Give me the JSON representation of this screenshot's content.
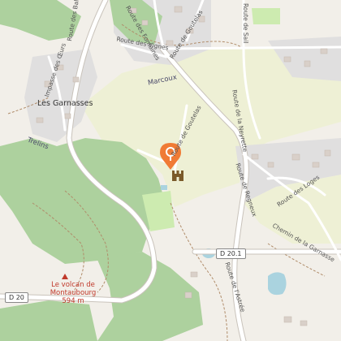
{
  "map": {
    "places": {
      "garnasses": "Les Garnasses",
      "marcoux": "Marcoux",
      "trelins": "Trelins"
    },
    "roads": {
      "balcons": "Route des Balcons",
      "oeurs": "Impasse des Œurs",
      "fontaines": "Route des Fontaines",
      "vignes": "Route des Vignes",
      "goutelas_top": "Route de Goutelas",
      "goutelas_mid": "Route de Goutelas",
      "sail": "Route de Sail",
      "neyrette": "Route de la Neyrette",
      "regneux": "Route de Regneux",
      "loges": "Route des Loges",
      "garnasse_chemin": "Chemin de la Garnasse",
      "astree": "Route de l'Astrée"
    },
    "shields": {
      "d201": "D 20.1",
      "d20": "D 20"
    },
    "peak": {
      "name": "Le volcan de Montaubourg",
      "elevation": "594 m"
    }
  },
  "colors": {
    "background": "#f2efe9",
    "forest": "#add19e",
    "farmland": "#eef0d5",
    "meadow": "#cdebb0",
    "residential": "#e0dfdf",
    "building": "#d9d0c9",
    "road": "#ffffff",
    "marker": "#f07b35",
    "water": "#aad3df",
    "peak": "#c0392b"
  },
  "marker": {
    "icon": "location-pin-icon"
  },
  "castle": {
    "icon": "castle-icon"
  }
}
